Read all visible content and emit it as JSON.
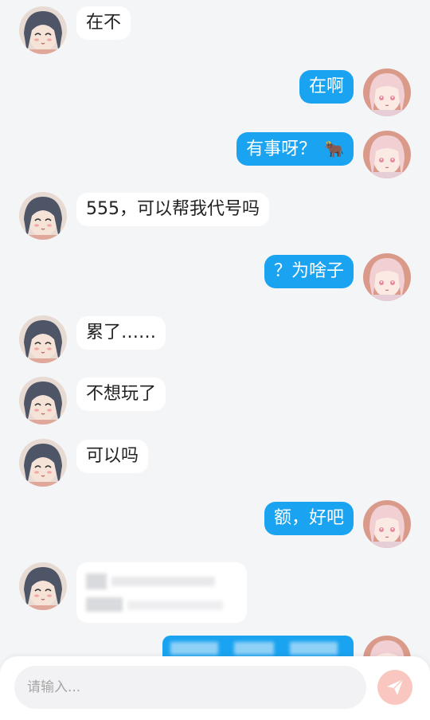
{
  "messages": [
    {
      "side": "left",
      "text": "在不"
    },
    {
      "side": "right",
      "text": "在啊"
    },
    {
      "side": "right",
      "text": "有事呀？",
      "emoji": "🐂"
    },
    {
      "side": "left",
      "text": "555，可以帮我代号吗"
    },
    {
      "side": "right",
      "text": "？为啥子"
    },
    {
      "side": "left",
      "text": "累了……"
    },
    {
      "side": "left",
      "text": "不想玩了"
    },
    {
      "side": "left",
      "text": "可以吗"
    },
    {
      "side": "right",
      "text": "额，好吧"
    },
    {
      "side": "left",
      "text": "",
      "redacted": true
    },
    {
      "side": "right",
      "text": "",
      "redacted": true
    }
  ],
  "input": {
    "placeholder": "请输入..."
  },
  "icons": {
    "send": "paper-plane-icon",
    "left_avatar": "girl-dark-hair-avatar",
    "right_avatar": "girl-pink-hair-avatar"
  },
  "colors": {
    "outgoing_bubble": "#1aa3f0",
    "incoming_bubble": "#ffffff",
    "background": "#f4f5f7",
    "send_button": "#f9c7c0"
  }
}
